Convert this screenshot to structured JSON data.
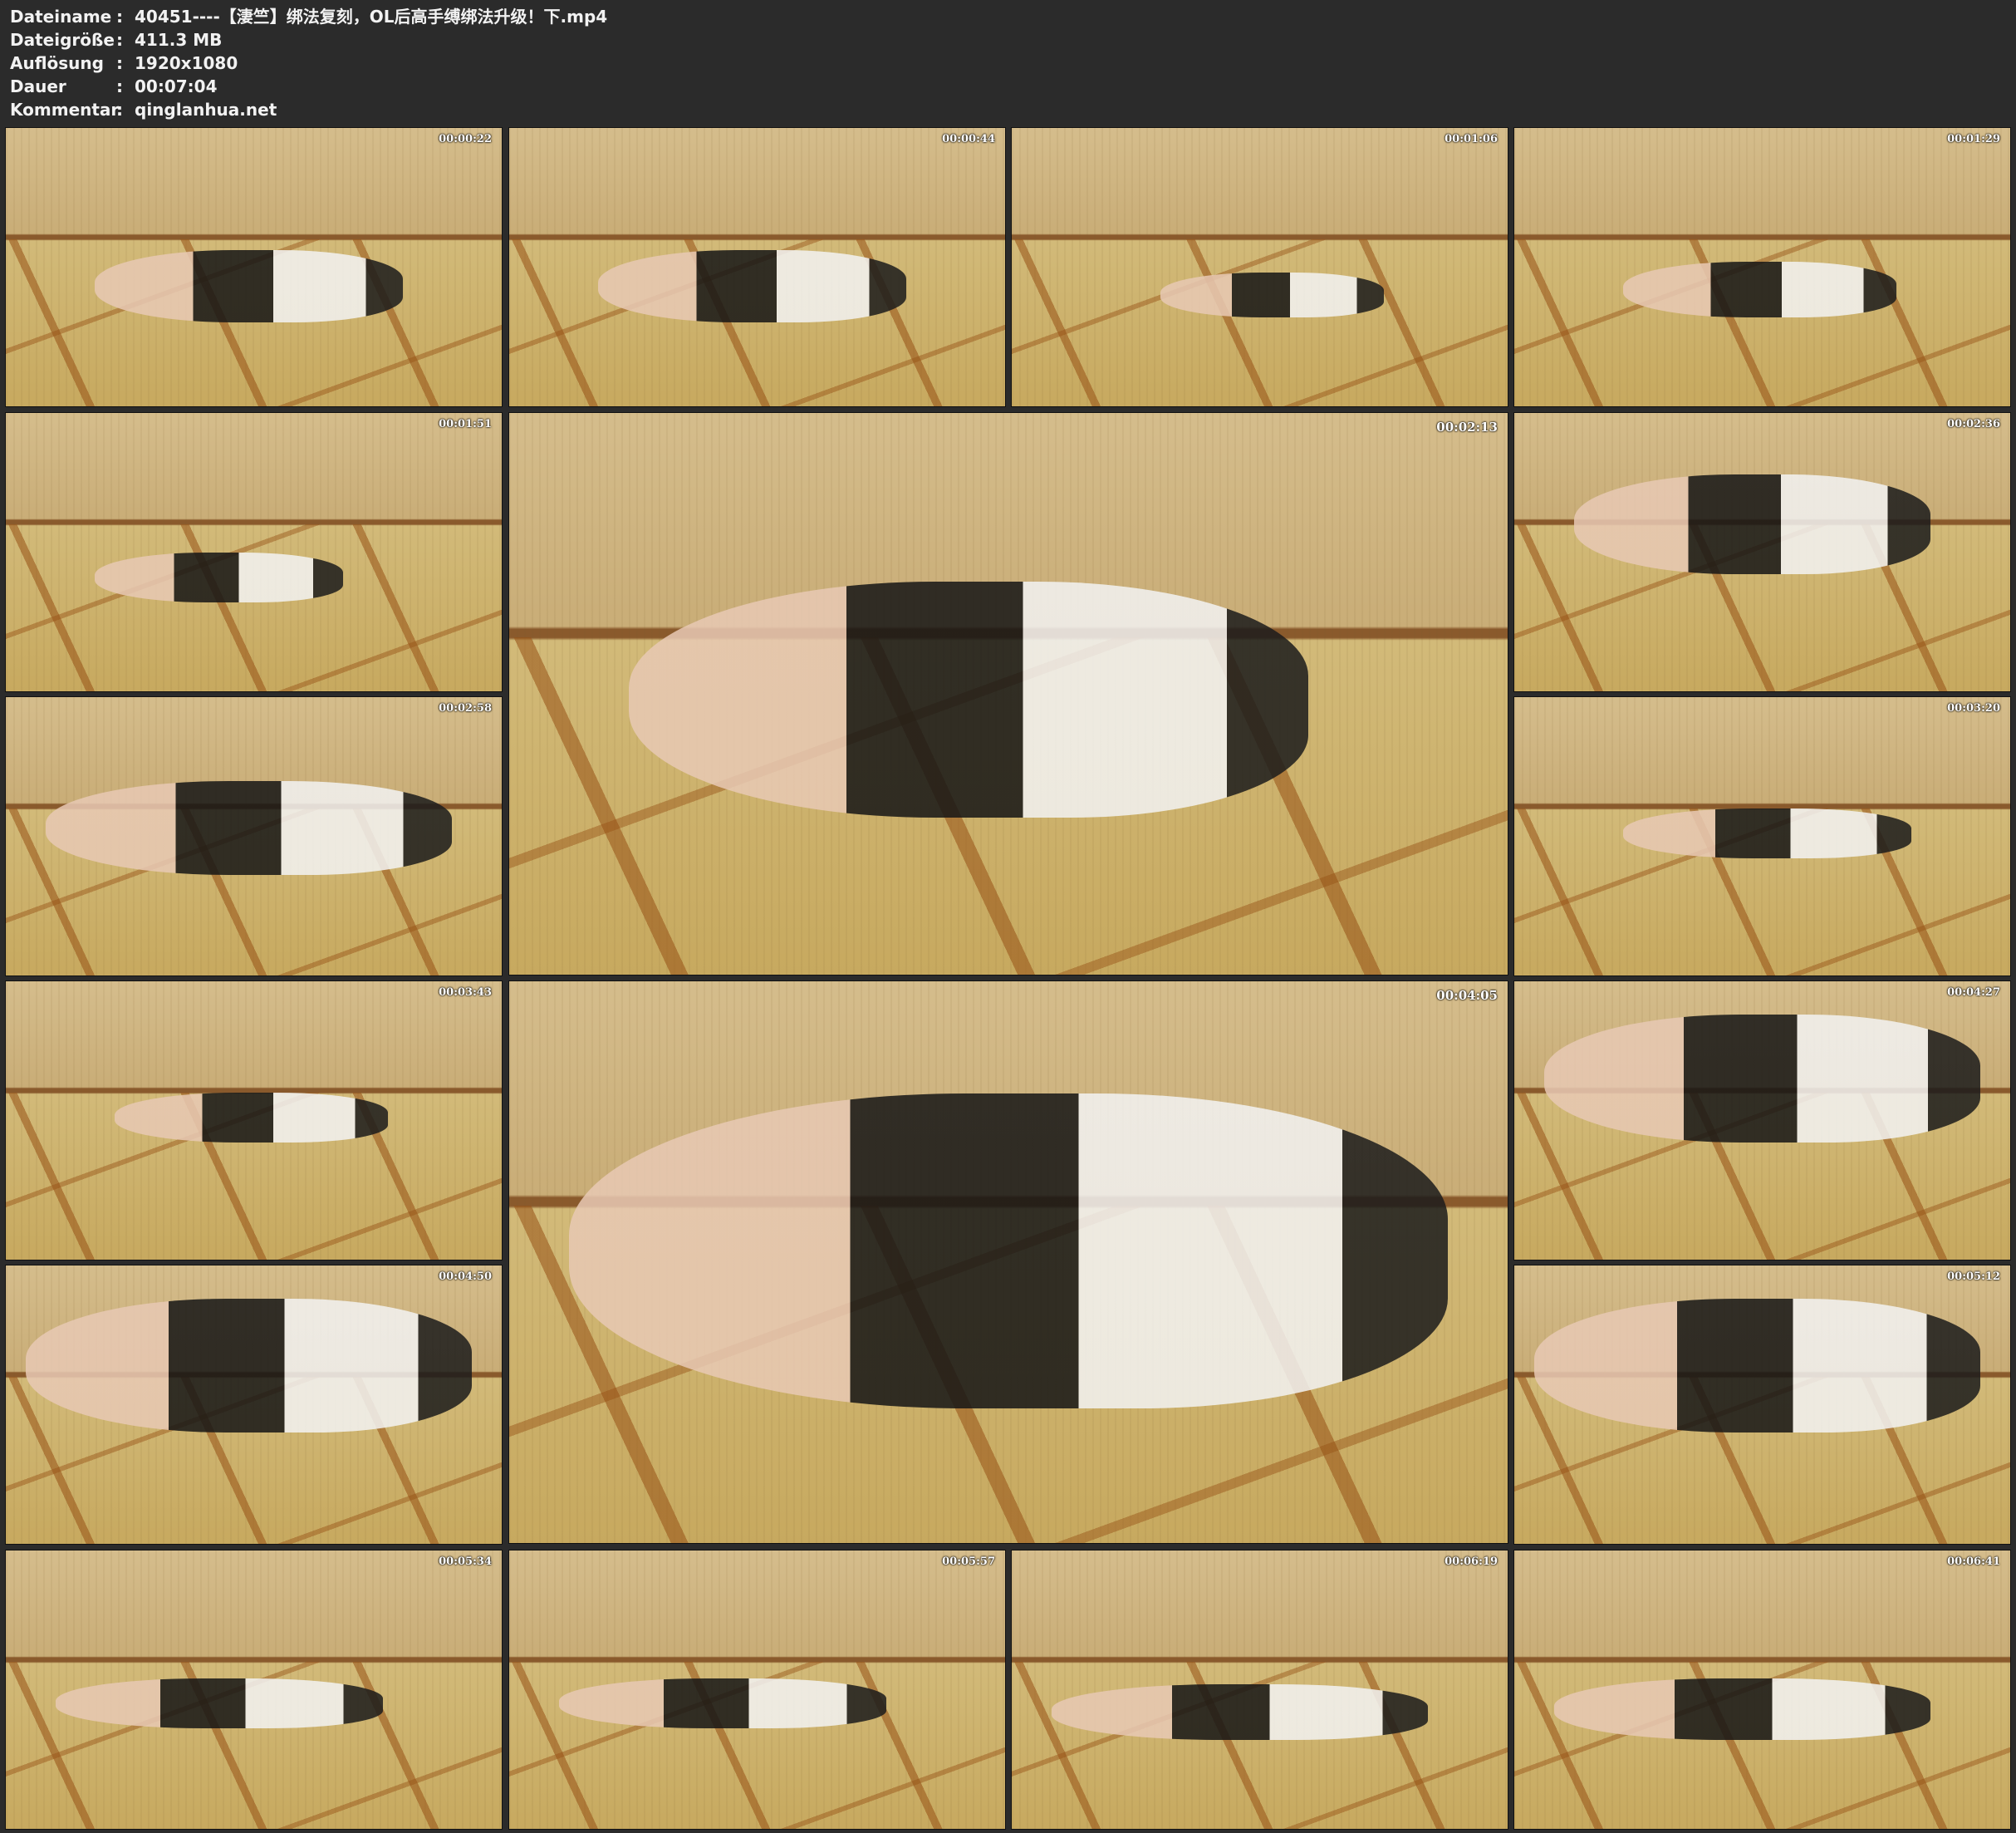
{
  "info": [
    {
      "key": "Dateiname",
      "sep": ":",
      "value": "40451----【淒竺】绑法复刻，OL后高手缚绑法升级！下.mp4"
    },
    {
      "key": "Dateigröße",
      "sep": ":",
      "value": "411.3 MB"
    },
    {
      "key": "Auflösung",
      "sep": ":",
      "value": "1920x1080"
    },
    {
      "key": "Dauer",
      "sep": ":",
      "value": "00:07:04"
    },
    {
      "key": "Kommentar",
      "sep": ":",
      "value": "qinglanhua.net"
    }
  ],
  "thumbnails": [
    {
      "ts": "00:00:22"
    },
    {
      "ts": "00:00:44"
    },
    {
      "ts": "00:01:06"
    },
    {
      "ts": "00:01:29"
    },
    {
      "ts": "00:01:51"
    },
    {
      "ts": "00:02:13"
    },
    {
      "ts": "00:02:36"
    },
    {
      "ts": "00:02:58"
    },
    {
      "ts": "00:03:20"
    },
    {
      "ts": "00:03:43"
    },
    {
      "ts": "00:04:05"
    },
    {
      "ts": "00:04:27"
    },
    {
      "ts": "00:04:50"
    },
    {
      "ts": "00:05:12"
    },
    {
      "ts": "00:05:34"
    },
    {
      "ts": "00:05:57"
    },
    {
      "ts": "00:06:19"
    },
    {
      "ts": "00:06:41"
    }
  ]
}
